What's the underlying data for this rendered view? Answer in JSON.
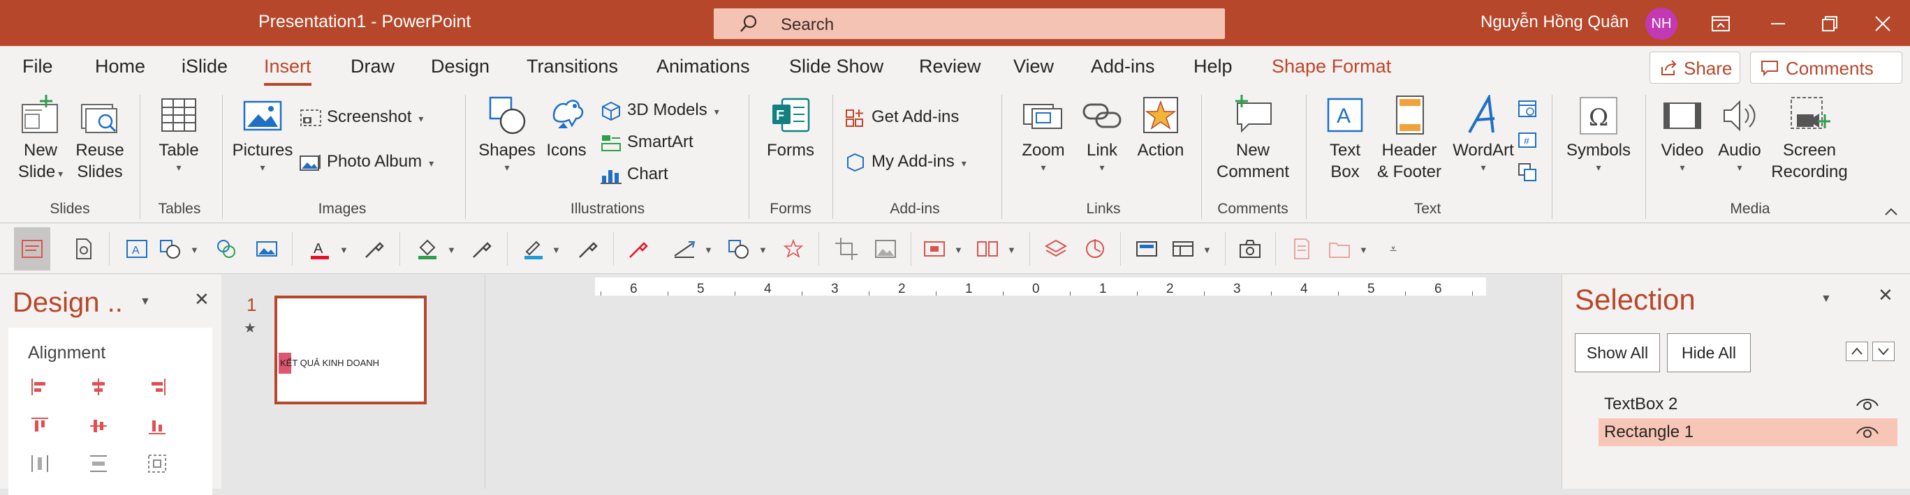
{
  "window": {
    "title": "Presentation1  -  PowerPoint",
    "search_label": "Search",
    "user_name": "Nguyễn Hồng Quân",
    "user_initials": "NH"
  },
  "tabs": [
    "File",
    "Home",
    "iSlide",
    "Insert",
    "Draw",
    "Design",
    "Transitions",
    "Animations",
    "Slide Show",
    "Review",
    "View",
    "Add-ins",
    "Help",
    "Shape Format"
  ],
  "active_tab": "Insert",
  "header_buttons": {
    "share": "Share",
    "comments": "Comments"
  },
  "ribbon": {
    "slides": {
      "label": "Slides",
      "new_slide": [
        "New",
        "Slide"
      ],
      "reuse_slides": [
        "Reuse",
        "Slides"
      ]
    },
    "tables": {
      "label": "Tables",
      "table": "Table"
    },
    "images": {
      "label": "Images",
      "pictures": "Pictures",
      "screenshot": "Screenshot",
      "photo_album": "Photo Album"
    },
    "illustrations": {
      "label": "Illustrations",
      "shapes": "Shapes",
      "icons": "Icons",
      "models_3d": "3D Models",
      "smartart": "SmartArt",
      "chart": "Chart"
    },
    "forms": {
      "label": "Forms",
      "forms": "Forms"
    },
    "addins": {
      "label": "Add-ins",
      "get_addins": "Get Add-ins",
      "my_addins": "My Add-ins"
    },
    "links": {
      "label": "Links",
      "zoom": "Zoom",
      "link": "Link",
      "action": "Action"
    },
    "comments": {
      "label": "Comments",
      "new_comment": [
        "New",
        "Comment"
      ]
    },
    "text": {
      "label": "Text",
      "text_box": [
        "Text",
        "Box"
      ],
      "header_footer": [
        "Header",
        "& Footer"
      ],
      "wordart": "WordArt"
    },
    "symbols": {
      "symbols": "Symbols"
    },
    "media": {
      "label": "Media",
      "video": "Video",
      "audio": "Audio",
      "screen_recording": [
        "Screen",
        "Recording"
      ]
    }
  },
  "design_pane": {
    "title": "Design ..",
    "section": "Alignment"
  },
  "thumbnails": {
    "slide_number": "1",
    "slide_text": "KẾT QUẢ KINH DOANH"
  },
  "ruler": {
    "ticks": [
      "6",
      "5",
      "4",
      "3",
      "2",
      "1",
      "0",
      "1",
      "2",
      "3",
      "4",
      "5",
      "6"
    ]
  },
  "selection_pane": {
    "title": "Selection",
    "show_all": "Show All",
    "hide_all": "Hide All",
    "items": [
      {
        "name": "TextBox 2",
        "selected": false
      },
      {
        "name": "Rectangle 1",
        "selected": true
      }
    ]
  },
  "colors": {
    "accent": "#b7472a",
    "search_bg": "#f4c3b4",
    "selected_item": "#f8c6b6",
    "avatar": "#c239b3"
  }
}
